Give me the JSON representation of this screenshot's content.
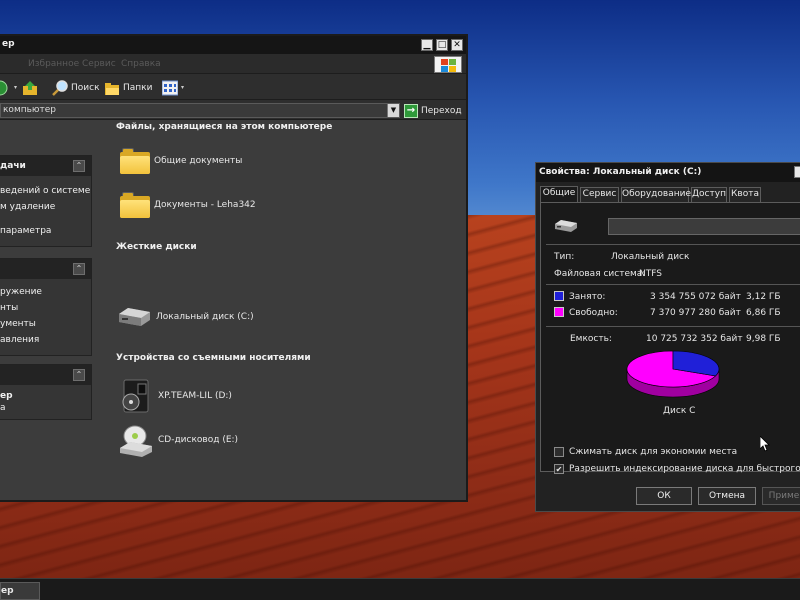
{
  "explorer": {
    "title": "ер",
    "menu": [
      "Избранное",
      "Сервис",
      "Справка"
    ],
    "toolbar": {
      "search": "Поиск",
      "folders": "Папки"
    },
    "address": {
      "value": "компьютер",
      "go_label": "Переход"
    },
    "side_panel": {
      "tasks_title": "дачи",
      "tasks_links": [
        "ведений о системе",
        "м удаление",
        "параметра"
      ],
      "places_links": [
        "ружение",
        "нты",
        "ументы",
        "авления"
      ],
      "details_name": "ер",
      "details_sub": "а"
    },
    "sections": {
      "files_title": "Файлы, хранящиеся на этом компьютере",
      "files": [
        "Общие документы",
        "Документы - Leha342"
      ],
      "hdd_title": "Жесткие диски",
      "hdd": [
        "Локальный диск (C:)"
      ],
      "removable_title": "Устройства со съемными носителями",
      "removable": [
        "XP.TEAM-LIL (D:)",
        "CD-дисковод (E:)"
      ]
    }
  },
  "properties": {
    "title": "Свойства: Локальный диск (C:)",
    "tabs": [
      "Общие",
      "Сервис",
      "Оборудование",
      "Доступ",
      "Квота"
    ],
    "active_tab": "Общие",
    "name_value": "",
    "type_label": "Тип:",
    "type_value": "Локальный диск",
    "fs_label": "Файловая система:",
    "fs_value": "NTFS",
    "used_label": "Занято:",
    "used_bytes": "3 354 755 072 байт",
    "used_gb": "3,12 ГБ",
    "free_label": "Свободно:",
    "free_bytes": "7 370 977 280 байт",
    "free_gb": "6,86 ГБ",
    "capacity_label": "Емкость:",
    "capacity_bytes": "10 725 732 352 байт",
    "capacity_gb": "9,98 ГБ",
    "used_fraction": 0.313,
    "used_color": "#2020d8",
    "free_color": "#ff00ff",
    "disk_label": "Диск C",
    "compress_label": "Сжимать диск для экономии места",
    "compress_checked": false,
    "index_label": "Разрешить индексирование диска для быстрого поиска",
    "index_checked": true,
    "ok_label": "ОК",
    "cancel_label": "Отмена",
    "apply_label": "Приме"
  },
  "taskbar": {
    "active_task": "ер"
  }
}
